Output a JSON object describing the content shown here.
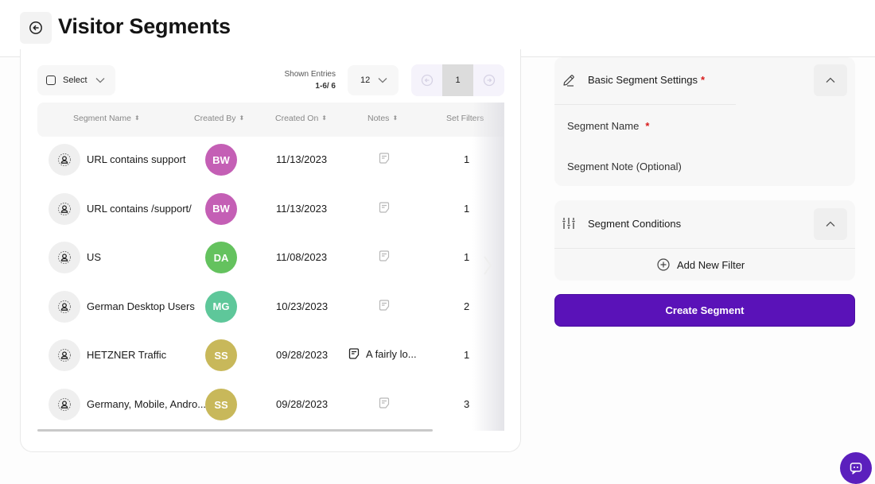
{
  "header": {
    "title": "Visitor Segments",
    "back_icon": "arrow-left-circle-icon"
  },
  "toolbar": {
    "select_label": "Select",
    "shown_entries_label": "Shown Entries",
    "shown_entries_value": "1-6/ 6",
    "per_page_value": "12",
    "current_page": "1"
  },
  "table": {
    "columns": [
      {
        "label": "Segment Name",
        "sortable": true
      },
      {
        "label": "Created By",
        "sortable": true
      },
      {
        "label": "Created On",
        "sortable": true
      },
      {
        "label": "Notes",
        "sortable": true
      },
      {
        "label": "Set Filters",
        "sortable": false
      }
    ],
    "rows": [
      {
        "name": "URL contains support",
        "initials": "BW",
        "avatar_color": "#c45fb5",
        "created_on": "11/13/2023",
        "note": "",
        "filters": "1"
      },
      {
        "name": "URL contains /support/",
        "initials": "BW",
        "avatar_color": "#c45fb5",
        "created_on": "11/13/2023",
        "note": "",
        "filters": "1"
      },
      {
        "name": "US",
        "initials": "DA",
        "avatar_color": "#64c25e",
        "created_on": "11/08/2023",
        "note": "",
        "filters": "1"
      },
      {
        "name": "German Desktop Users",
        "initials": "MG",
        "avatar_color": "#5ec79a",
        "created_on": "10/23/2023",
        "note": "",
        "filters": "2"
      },
      {
        "name": "HETZNER Traffic",
        "initials": "SS",
        "avatar_color": "#c8b85a",
        "created_on": "09/28/2023",
        "note": "A fairly lo...",
        "filters": "1"
      },
      {
        "name": "Germany, Mobile, Andro...",
        "initials": "SS",
        "avatar_color": "#c8b85a",
        "created_on": "09/28/2023",
        "note": "",
        "filters": "3"
      }
    ]
  },
  "settings_panel": {
    "title": "Basic Segment Settings",
    "required_mark": "*",
    "segment_name_label": "Segment Name",
    "segment_note_label": "Segment Note (Optional)"
  },
  "conditions_panel": {
    "title": "Segment Conditions",
    "add_filter_label": "Add New Filter"
  },
  "actions": {
    "create_label": "Create Segment"
  },
  "colors": {
    "primary": "#5a12b8",
    "required": "#d81b1b"
  }
}
